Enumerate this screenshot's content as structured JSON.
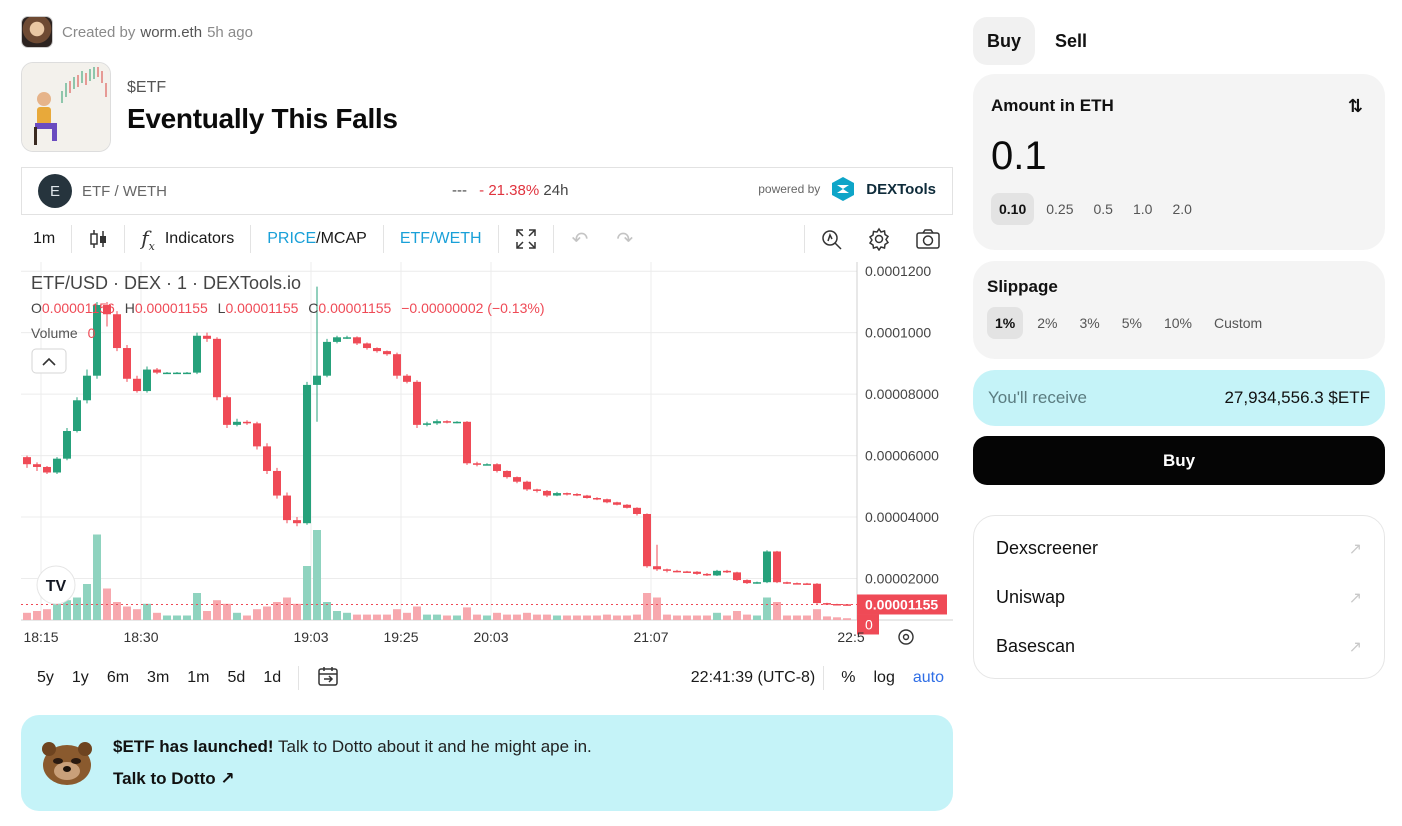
{
  "creator": {
    "prefix": "Created by",
    "name": "worm.eth",
    "time": "5h ago"
  },
  "token": {
    "ticker": "$ETF",
    "title": "Eventually This Falls"
  },
  "pair": {
    "circle_letter": "E",
    "name": "ETF / WETH",
    "price": "---",
    "change": "- 21.38%",
    "period": "24h",
    "powered_by": "powered by",
    "provider": "DEXTools"
  },
  "toolbar": {
    "interval": "1m",
    "indicators": "Indicators",
    "price": "PRICE",
    "mcap": "/MCAP",
    "pair": "ETF/WETH"
  },
  "chart": {
    "title": "ETF/USD · DEX · 1 · DEXTools.io"
  },
  "chart_data": {
    "type": "candlestick",
    "legend": {
      "o": "0.00001156",
      "h": "0.00001155",
      "l": "0.00001155",
      "c": "0.00001155",
      "change": "−0.00000002 (−0.13%)",
      "volume_label": "Volume",
      "volume_value": "0"
    },
    "y_ticks": [
      "0.0001200",
      "0.0001000",
      "0.00008000",
      "0.00006000",
      "0.00004000",
      "0.00002000"
    ],
    "y_tick_values": [
      0.00012,
      0.0001,
      8e-05,
      6e-05,
      4e-05,
      2e-05
    ],
    "ylim": [
      6.5e-06,
      0.000123
    ],
    "x_ticks": [
      "18:15",
      "18:30",
      "19:03",
      "19:25",
      "20:03",
      "21:07",
      "22:5"
    ],
    "last_price": "0.00001155",
    "last_volume": "0",
    "candles": [
      {
        "o": 5.95e-05,
        "c": 5.72e-05,
        "h": 6e-05,
        "l": 5.6e-05,
        "v": 8
      },
      {
        "o": 5.72e-05,
        "c": 5.63e-05,
        "h": 5.78e-05,
        "l": 5.5e-05,
        "v": 10
      },
      {
        "o": 5.63e-05,
        "c": 5.45e-05,
        "h": 5.66e-05,
        "l": 5.4e-05,
        "v": 12
      },
      {
        "o": 5.45e-05,
        "c": 5.9e-05,
        "h": 5.95e-05,
        "l": 5.4e-05,
        "v": 18
      },
      {
        "o": 5.9e-05,
        "c": 6.8e-05,
        "h": 6.9e-05,
        "l": 5.85e-05,
        "v": 22
      },
      {
        "o": 6.8e-05,
        "c": 7.8e-05,
        "h": 7.9e-05,
        "l": 6.75e-05,
        "v": 25
      },
      {
        "o": 7.8e-05,
        "c": 8.6e-05,
        "h": 8.8e-05,
        "l": 7.7e-05,
        "v": 40
      },
      {
        "o": 8.6e-05,
        "c": 0.000109,
        "h": 0.00011,
        "l": 8.5e-05,
        "v": 95
      },
      {
        "o": 0.000109,
        "c": 0.000106,
        "h": 0.00011,
        "l": 0.000102,
        "v": 35
      },
      {
        "o": 0.000106,
        "c": 9.5e-05,
        "h": 0.000107,
        "l": 9.4e-05,
        "v": 20
      },
      {
        "o": 9.5e-05,
        "c": 8.5e-05,
        "h": 9.6e-05,
        "l": 8.4e-05,
        "v": 15
      },
      {
        "o": 8.5e-05,
        "c": 8.1e-05,
        "h": 8.6e-05,
        "l": 8.05e-05,
        "v": 12
      },
      {
        "o": 8.1e-05,
        "c": 8.8e-05,
        "h": 8.9e-05,
        "l": 8.05e-05,
        "v": 18
      },
      {
        "o": 8.8e-05,
        "c": 8.7e-05,
        "h": 8.85e-05,
        "l": 8.65e-05,
        "v": 8
      },
      {
        "o": 8.7e-05,
        "c": 8.7e-05,
        "h": 8.72e-05,
        "l": 8.68e-05,
        "v": 5
      },
      {
        "o": 8.7e-05,
        "c": 8.7e-05,
        "h": 8.72e-05,
        "l": 8.68e-05,
        "v": 5
      },
      {
        "o": 8.7e-05,
        "c": 8.7e-05,
        "h": 8.72e-05,
        "l": 8.68e-05,
        "v": 5
      },
      {
        "o": 8.7e-05,
        "c": 9.9e-05,
        "h": 0.0001,
        "l": 8.65e-05,
        "v": 30
      },
      {
        "o": 9.9e-05,
        "c": 9.8e-05,
        "h": 0.0001,
        "l": 9.7e-05,
        "v": 10
      },
      {
        "o": 9.8e-05,
        "c": 7.9e-05,
        "h": 9.85e-05,
        "l": 7.8e-05,
        "v": 22
      },
      {
        "o": 7.9e-05,
        "c": 7e-05,
        "h": 7.95e-05,
        "l": 6.9e-05,
        "v": 18
      },
      {
        "o": 7e-05,
        "c": 7.1e-05,
        "h": 7.2e-05,
        "l": 6.95e-05,
        "v": 8
      },
      {
        "o": 7.1e-05,
        "c": 7.05e-05,
        "h": 7.15e-05,
        "l": 7e-05,
        "v": 5
      },
      {
        "o": 7.05e-05,
        "c": 6.3e-05,
        "h": 7.1e-05,
        "l": 6.2e-05,
        "v": 12
      },
      {
        "o": 6.3e-05,
        "c": 5.5e-05,
        "h": 6.4e-05,
        "l": 5.4e-05,
        "v": 15
      },
      {
        "o": 5.5e-05,
        "c": 4.7e-05,
        "h": 5.6e-05,
        "l": 4.6e-05,
        "v": 20
      },
      {
        "o": 4.7e-05,
        "c": 3.9e-05,
        "h": 4.8e-05,
        "l": 3.8e-05,
        "v": 25
      },
      {
        "o": 3.9e-05,
        "c": 3.8e-05,
        "h": 4e-05,
        "l": 3.7e-05,
        "v": 18
      },
      {
        "o": 3.8e-05,
        "c": 8.3e-05,
        "h": 8.4e-05,
        "l": 3.75e-05,
        "v": 60
      },
      {
        "o": 8.3e-05,
        "c": 8.6e-05,
        "h": 0.000115,
        "l": 7.1e-05,
        "v": 100
      },
      {
        "o": 8.6e-05,
        "c": 9.7e-05,
        "h": 9.8e-05,
        "l": 8.55e-05,
        "v": 20
      },
      {
        "o": 9.7e-05,
        "c": 9.85e-05,
        "h": 9.9e-05,
        "l": 9.65e-05,
        "v": 10
      },
      {
        "o": 9.85e-05,
        "c": 9.85e-05,
        "h": 9.9e-05,
        "l": 9.8e-05,
        "v": 8
      },
      {
        "o": 9.85e-05,
        "c": 9.65e-05,
        "h": 9.88e-05,
        "l": 9.6e-05,
        "v": 6
      },
      {
        "o": 9.65e-05,
        "c": 9.5e-05,
        "h": 9.68e-05,
        "l": 9.45e-05,
        "v": 6
      },
      {
        "o": 9.5e-05,
        "c": 9.4e-05,
        "h": 9.52e-05,
        "l": 9.35e-05,
        "v": 6
      },
      {
        "o": 9.4e-05,
        "c": 9.3e-05,
        "h": 9.42e-05,
        "l": 9.25e-05,
        "v": 6
      },
      {
        "o": 9.3e-05,
        "c": 8.6e-05,
        "h": 9.35e-05,
        "l": 8.5e-05,
        "v": 12
      },
      {
        "o": 8.6e-05,
        "c": 8.4e-05,
        "h": 8.65e-05,
        "l": 8.35e-05,
        "v": 8
      },
      {
        "o": 8.4e-05,
        "c": 7e-05,
        "h": 8.45e-05,
        "l": 6.9e-05,
        "v": 15
      },
      {
        "o": 7e-05,
        "c": 7.05e-05,
        "h": 7.1e-05,
        "l": 6.95e-05,
        "v": 6
      },
      {
        "o": 7.05e-05,
        "c": 7.12e-05,
        "h": 7.18e-05,
        "l": 7e-05,
        "v": 6
      },
      {
        "o": 7.12e-05,
        "c": 7.08e-05,
        "h": 7.15e-05,
        "l": 7.05e-05,
        "v": 5
      },
      {
        "o": 7.08e-05,
        "c": 7.1e-05,
        "h": 7.12e-05,
        "l": 7.05e-05,
        "v": 5
      },
      {
        "o": 7.1e-05,
        "c": 5.75e-05,
        "h": 7.12e-05,
        "l": 5.7e-05,
        "v": 14
      },
      {
        "o": 5.75e-05,
        "c": 5.7e-05,
        "h": 5.8e-05,
        "l": 5.65e-05,
        "v": 6
      },
      {
        "o": 5.7e-05,
        "c": 5.72e-05,
        "h": 5.75e-05,
        "l": 5.68e-05,
        "v": 5
      },
      {
        "o": 5.72e-05,
        "c": 5.5e-05,
        "h": 5.75e-05,
        "l": 5.45e-05,
        "v": 8
      },
      {
        "o": 5.5e-05,
        "c": 5.3e-05,
        "h": 5.52e-05,
        "l": 5.25e-05,
        "v": 6
      },
      {
        "o": 5.3e-05,
        "c": 5.15e-05,
        "h": 5.32e-05,
        "l": 5.1e-05,
        "v": 6
      },
      {
        "o": 5.15e-05,
        "c": 4.9e-05,
        "h": 5.18e-05,
        "l": 4.85e-05,
        "v": 8
      },
      {
        "o": 4.9e-05,
        "c": 4.85e-05,
        "h": 4.92e-05,
        "l": 4.8e-05,
        "v": 6
      },
      {
        "o": 4.85e-05,
        "c": 4.7e-05,
        "h": 4.88e-05,
        "l": 4.65e-05,
        "v": 6
      },
      {
        "o": 4.7e-05,
        "c": 4.78e-05,
        "h": 4.82e-05,
        "l": 4.68e-05,
        "v": 5
      },
      {
        "o": 4.78e-05,
        "c": 4.75e-05,
        "h": 4.8e-05,
        "l": 4.7e-05,
        "v": 5
      },
      {
        "o": 4.75e-05,
        "c": 4.7e-05,
        "h": 4.78e-05,
        "l": 4.68e-05,
        "v": 5
      },
      {
        "o": 4.7e-05,
        "c": 4.62e-05,
        "h": 4.72e-05,
        "l": 4.6e-05,
        "v": 5
      },
      {
        "o": 4.62e-05,
        "c": 4.58e-05,
        "h": 4.65e-05,
        "l": 4.55e-05,
        "v": 5
      },
      {
        "o": 4.58e-05,
        "c": 4.48e-05,
        "h": 4.6e-05,
        "l": 4.45e-05,
        "v": 6
      },
      {
        "o": 4.48e-05,
        "c": 4.4e-05,
        "h": 4.5e-05,
        "l": 4.38e-05,
        "v": 5
      },
      {
        "o": 4.4e-05,
        "c": 4.3e-05,
        "h": 4.42e-05,
        "l": 4.28e-05,
        "v": 5
      },
      {
        "o": 4.3e-05,
        "c": 4.1e-05,
        "h": 4.32e-05,
        "l": 4.05e-05,
        "v": 6
      },
      {
        "o": 4.1e-05,
        "c": 2.4e-05,
        "h": 4.12e-05,
        "l": 2.35e-05,
        "v": 30
      },
      {
        "o": 2.4e-05,
        "c": 2.3e-05,
        "h": 3.1e-05,
        "l": 2.25e-05,
        "v": 25
      },
      {
        "o": 2.3e-05,
        "c": 2.25e-05,
        "h": 2.32e-05,
        "l": 2.2e-05,
        "v": 6
      },
      {
        "o": 2.25e-05,
        "c": 2.23e-05,
        "h": 2.28e-05,
        "l": 2.2e-05,
        "v": 5
      },
      {
        "o": 2.23e-05,
        "c": 2.22e-05,
        "h": 2.25e-05,
        "l": 2.2e-05,
        "v": 5
      },
      {
        "o": 2.22e-05,
        "c": 2.15e-05,
        "h": 2.24e-05,
        "l": 2.12e-05,
        "v": 5
      },
      {
        "o": 2.15e-05,
        "c": 2.1e-05,
        "h": 2.18e-05,
        "l": 2.08e-05,
        "v": 5
      },
      {
        "o": 2.1e-05,
        "c": 2.25e-05,
        "h": 2.28e-05,
        "l": 2.08e-05,
        "v": 8
      },
      {
        "o": 2.25e-05,
        "c": 2.2e-05,
        "h": 2.28e-05,
        "l": 2.18e-05,
        "v": 5
      },
      {
        "o": 2.2e-05,
        "c": 1.95e-05,
        "h": 2.22e-05,
        "l": 1.92e-05,
        "v": 10
      },
      {
        "o": 1.95e-05,
        "c": 1.85e-05,
        "h": 1.97e-05,
        "l": 1.82e-05,
        "v": 6
      },
      {
        "o": 1.85e-05,
        "c": 1.88e-05,
        "h": 1.9e-05,
        "l": 1.83e-05,
        "v": 5
      },
      {
        "o": 1.88e-05,
        "c": 2.88e-05,
        "h": 2.92e-05,
        "l": 1.85e-05,
        "v": 25
      },
      {
        "o": 2.88e-05,
        "c": 1.88e-05,
        "h": 2.9e-05,
        "l": 1.85e-05,
        "v": 20
      },
      {
        "o": 1.88e-05,
        "c": 1.85e-05,
        "h": 1.9e-05,
        "l": 1.82e-05,
        "v": 5
      },
      {
        "o": 1.85e-05,
        "c": 1.84e-05,
        "h": 1.87e-05,
        "l": 1.82e-05,
        "v": 5
      },
      {
        "o": 1.84e-05,
        "c": 1.83e-05,
        "h": 1.86e-05,
        "l": 1.81e-05,
        "v": 5
      },
      {
        "o": 1.83e-05,
        "c": 1.2e-05,
        "h": 1.85e-05,
        "l": 1.18e-05,
        "v": 12
      },
      {
        "o": 1.2e-05,
        "c": 1.17e-05,
        "h": 1.21e-05,
        "l": 1.15e-05,
        "v": 4
      },
      {
        "o": 1.17e-05,
        "c": 1.16e-05,
        "h": 1.18e-05,
        "l": 1.15e-05,
        "v": 3
      },
      {
        "o": 1.16e-05,
        "c": 1.15e-05,
        "h": 1.17e-05,
        "l": 1.15e-05,
        "v": 2
      }
    ]
  },
  "ranges": {
    "items": [
      "5y",
      "1y",
      "6m",
      "3m",
      "1m",
      "5d",
      "1d"
    ],
    "time": "22:41:39 (UTC-8)",
    "percent": "%",
    "log": "log",
    "auto": "auto"
  },
  "banner": {
    "bold": "$ETF has launched!",
    "text": " Talk to Dotto about it and he might ape in.",
    "link": "Talk to Dotto ↗"
  },
  "trade": {
    "tabs": [
      "Buy",
      "Sell"
    ],
    "amount_label": "Amount in ETH",
    "amount": "0.1",
    "presets": [
      "0.10",
      "0.25",
      "0.5",
      "1.0",
      "2.0"
    ],
    "slippage_label": "Slippage",
    "slippage": [
      "1%",
      "2%",
      "3%",
      "5%",
      "10%",
      "Custom"
    ],
    "receive_label": "You'll receive",
    "receive_value": "27,934,556.3 $ETF",
    "buy_label": "Buy"
  },
  "links": [
    "Dexscreener",
    "Uniswap",
    "Basescan"
  ],
  "colors": {
    "up": "#26a17b",
    "down": "#ef4a56",
    "accent": "#c5f3f8"
  }
}
